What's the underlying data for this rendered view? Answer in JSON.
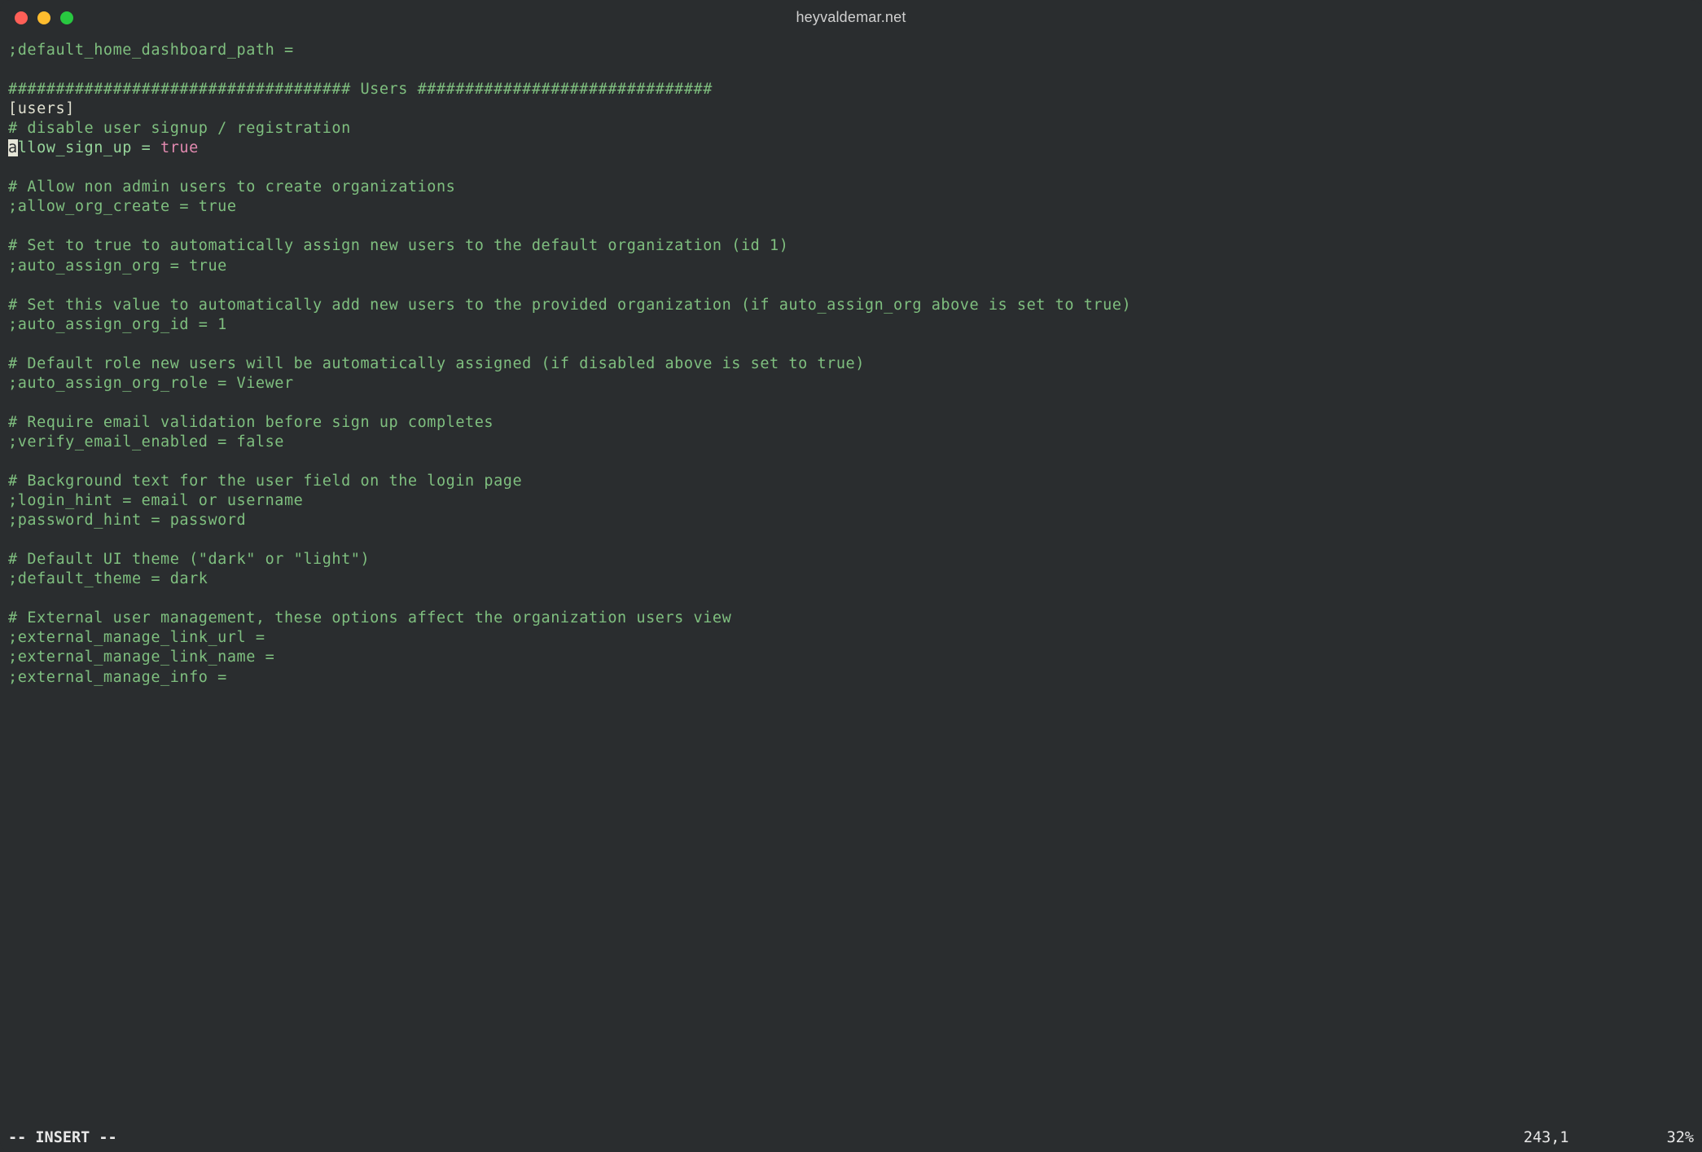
{
  "window": {
    "title": "heyvaldemar.net"
  },
  "editor": {
    "l1": ";default_home_dashboard_path =",
    "l2": "",
    "l3": "#################################### Users ###############################",
    "l4": "[users]",
    "l5": "# disable user signup / registration",
    "l6_cursor": "a",
    "l6_key": "llow_sign_up",
    "l6_eq": " = ",
    "l6_val": "true",
    "l7": "",
    "l8": "# Allow non admin users to create organizations",
    "l9": ";allow_org_create = true",
    "l10": "",
    "l11": "# Set to true to automatically assign new users to the default organization (id 1)",
    "l12": ";auto_assign_org = true",
    "l13": "",
    "l14": "# Set this value to automatically add new users to the provided organization (if auto_assign_org above is set to true)",
    "l15": ";auto_assign_org_id = 1",
    "l16": "",
    "l17": "# Default role new users will be automatically assigned (if disabled above is set to true)",
    "l18": ";auto_assign_org_role = Viewer",
    "l19": "",
    "l20": "# Require email validation before sign up completes",
    "l21": ";verify_email_enabled = false",
    "l22": "",
    "l23": "# Background text for the user field on the login page",
    "l24": ";login_hint = email or username",
    "l25": ";password_hint = password",
    "l26": "",
    "l27": "# Default UI theme (\"dark\" or \"light\")",
    "l28": ";default_theme = dark",
    "l29": "",
    "l30": "# External user management, these options affect the organization users view",
    "l31": ";external_manage_link_url =",
    "l32": ";external_manage_link_name =",
    "l33": ";external_manage_info ="
  },
  "status": {
    "mode": "-- INSERT --",
    "position": "243,1",
    "percent": "32%"
  }
}
